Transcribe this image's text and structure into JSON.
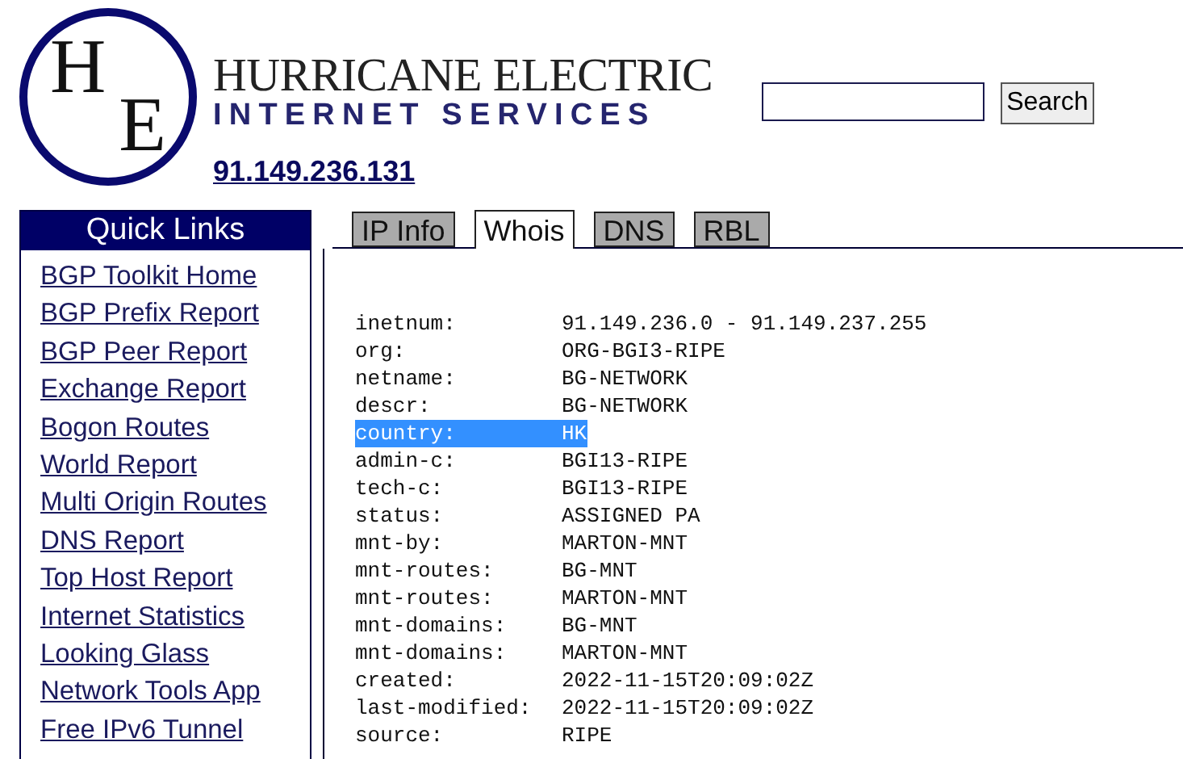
{
  "header": {
    "logo_monogram": [
      "H",
      "E"
    ],
    "logo_title": "HURRICANE ELECTRIC",
    "logo_subtitle": "INTERNET SERVICES",
    "search_button": "Search",
    "ip_link": "91.149.236.131"
  },
  "sidebar": {
    "title": "Quick Links",
    "items": [
      "BGP Toolkit Home",
      "BGP Prefix Report",
      "BGP Peer Report",
      "Exchange Report",
      "Bogon Routes",
      "World Report",
      "Multi Origin Routes",
      "DNS Report",
      "Top Host Report",
      "Internet Statistics",
      "Looking Glass",
      "Network Tools App",
      "Free IPv6 Tunnel"
    ]
  },
  "tabs": [
    {
      "label": "IP Info",
      "selected": false
    },
    {
      "label": "Whois",
      "selected": true
    },
    {
      "label": "DNS",
      "selected": false
    },
    {
      "label": "RBL",
      "selected": false
    }
  ],
  "whois": [
    {
      "key": "inetnum:",
      "value": "91.149.236.0 - 91.149.237.255",
      "selected": false
    },
    {
      "key": "org:",
      "value": "ORG-BGI3-RIPE",
      "selected": false
    },
    {
      "key": "netname:",
      "value": "BG-NETWORK",
      "selected": false
    },
    {
      "key": "descr:",
      "value": "BG-NETWORK",
      "selected": false
    },
    {
      "key": "country:",
      "value": "HK",
      "selected": true
    },
    {
      "key": "admin-c:",
      "value": "BGI13-RIPE",
      "selected": false
    },
    {
      "key": "tech-c:",
      "value": "BGI13-RIPE",
      "selected": false
    },
    {
      "key": "status:",
      "value": "ASSIGNED PA",
      "selected": false
    },
    {
      "key": "mnt-by:",
      "value": "MARTON-MNT",
      "selected": false
    },
    {
      "key": "mnt-routes:",
      "value": "BG-MNT",
      "selected": false
    },
    {
      "key": "mnt-routes:",
      "value": "MARTON-MNT",
      "selected": false
    },
    {
      "key": "mnt-domains:",
      "value": "BG-MNT",
      "selected": false
    },
    {
      "key": "mnt-domains:",
      "value": "MARTON-MNT",
      "selected": false
    },
    {
      "key": "created:",
      "value": "2022-11-15T20:09:02Z",
      "selected": false
    },
    {
      "key": "last-modified:",
      "value": "2022-11-15T20:09:02Z",
      "selected": false
    },
    {
      "key": "source:",
      "value": "RIPE",
      "selected": false
    }
  ]
}
